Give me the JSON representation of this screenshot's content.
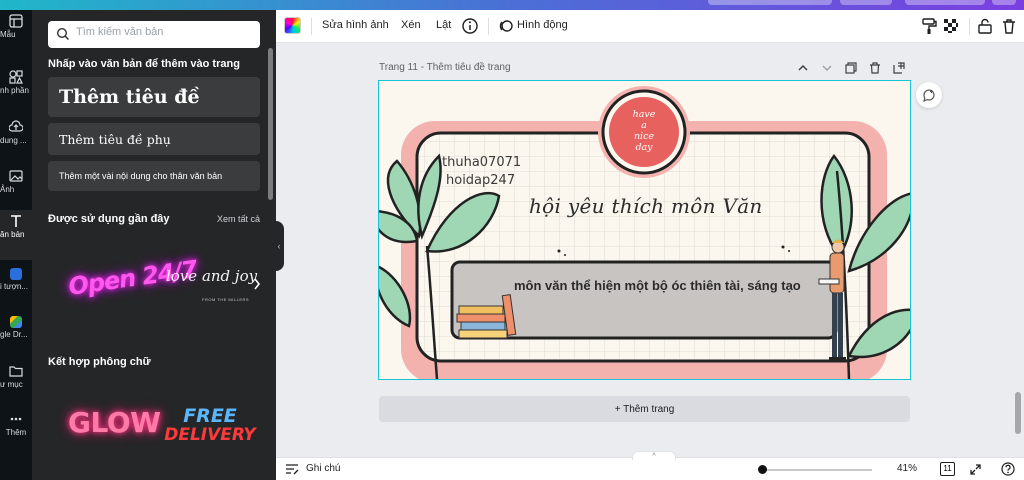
{
  "rail": {
    "items": [
      {
        "label": "Mẫu",
        "icon": "template-icon"
      },
      {
        "label": "nh phần",
        "icon": "elements-icon"
      },
      {
        "label": "dung ...",
        "icon": "upload-icon"
      },
      {
        "label": "Ảnh",
        "icon": "photo-icon"
      },
      {
        "label": "ăn bản",
        "icon": "text-icon"
      },
      {
        "label": "i tượn...",
        "icon": "app-icon"
      },
      {
        "label": "gle Dr...",
        "icon": "google-drive-icon"
      },
      {
        "label": "ư mục",
        "icon": "folder-icon"
      },
      {
        "label": "Thêm",
        "icon": "more-icon"
      }
    ]
  },
  "panel": {
    "search_placeholder": "Tìm kiếm văn bản",
    "click_title": "Nhấp vào văn bản để thêm vào trang",
    "heading_btn": "Thêm tiêu đề",
    "subheading_btn": "Thêm tiêu đề phụ",
    "body_btn": "Thêm một vài nội dung cho thân văn bản",
    "recent_title": "Được sử dụng gần đây",
    "see_all": "Xem tất cả",
    "recent_1": "Open 24/7",
    "recent_2": "love and joy",
    "recent_2_sub": "FROM THE MILLERS",
    "combo_title": "Kết hợp phông chữ",
    "combo_1": "GLOW",
    "combo_2_top": "FREE",
    "combo_2_bottom": "DELIVERY"
  },
  "toolbar": {
    "edit_image": "Sửa hình ảnh",
    "crop": "Xén",
    "flip": "Lật",
    "animate": "Hình động"
  },
  "canvas": {
    "page_label": "Trang 11 - Thêm tiêu đề trang",
    "user_line1": "thuha07071",
    "user_line2": "hoidap247",
    "headline": "hội yêu thích môn Văn",
    "banner": "môn văn thể hiện một bộ óc thiên tài, sáng tạo",
    "badge_lines": [
      "have",
      "a",
      "nice",
      "day"
    ],
    "add_page": "+ Thêm trang"
  },
  "bottombar": {
    "notes": "Ghi chú",
    "zoom": "41%",
    "page_count": "11",
    "zoom_level": 0.41
  },
  "colors": {
    "accent": "#17c3d6",
    "panel_bg": "#252627",
    "rail_bg": "#0e1318",
    "frame_pink": "#f3b2ad",
    "leaf_green": "#9fd6b4",
    "badge_red": "#e7625e"
  }
}
